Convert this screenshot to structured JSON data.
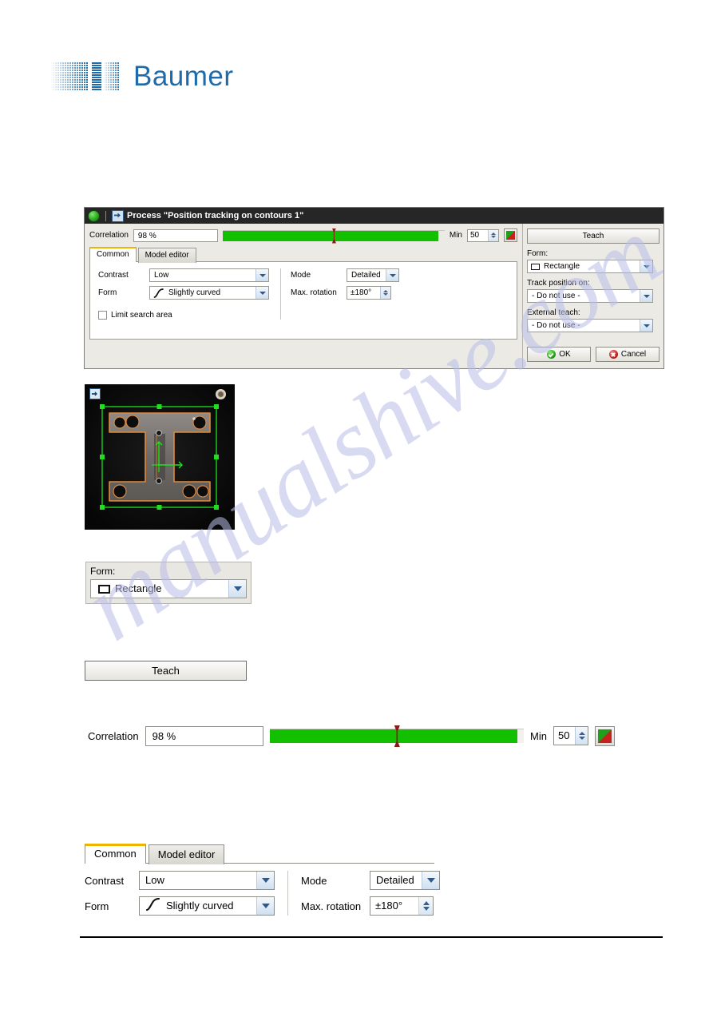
{
  "brand": {
    "name": "Baumer",
    "logo_color": "#1f6aa8"
  },
  "watermark": {
    "text": "manualshive.com"
  },
  "dialog": {
    "titlebar": {
      "title": "Process \"Position tracking on contours 1\"",
      "status_icon": "green-status-circle-icon",
      "app_icon": "process-node-icon"
    },
    "correlation": {
      "label": "Correlation",
      "value": "98 %",
      "bar_fill_percent": 100,
      "marker_percent": 50,
      "min_label": "Min",
      "min_value": "50",
      "fill_color": "#12c000",
      "marker_color": "#8a1b16",
      "flag_button_icon": "green-red-diagonal-flag-icon"
    },
    "tabs": [
      {
        "label": "Common",
        "active": true
      },
      {
        "label": "Model editor",
        "active": false
      }
    ],
    "common_tab": {
      "contrast_label": "Contrast",
      "contrast_value": "Low",
      "form_label": "Form",
      "form_value": "Slightly curved",
      "form_icon": "curve-icon",
      "mode_label": "Mode",
      "mode_value": "Detailed",
      "max_rotation_label": "Max. rotation",
      "max_rotation_value": "±180°",
      "limit_search_area_label": "Limit search area",
      "limit_search_area_checked": false
    },
    "right_panel": {
      "teach_label": "Teach",
      "form_label": "Form:",
      "form_value": "Rectangle",
      "form_icon": "rectangle-icon",
      "track_position_label": "Track position on:",
      "track_position_value": "- Do not use -",
      "external_teach_label": "External teach:",
      "external_teach_value": "- Do not use -",
      "ok_label": "OK",
      "cancel_label": "Cancel"
    }
  },
  "preview": {
    "overlay_icon": "process-node-icon",
    "corner_knob_icon": "round-knob-icon",
    "roi_color": "#1ee01e",
    "contour_color": "#e08a3c",
    "background_color": "#090909"
  },
  "form_zoom": {
    "label": "Form:",
    "value": "Rectangle",
    "icon": "rectangle-icon"
  },
  "teach_zoom": {
    "label": "Teach"
  },
  "correlation_zoom": {
    "label": "Correlation",
    "value": "98 %",
    "bar_fill_percent": 100,
    "marker_percent": 50,
    "min_label": "Min",
    "min_value": "50",
    "flag_button_icon": "green-red-diagonal-flag-icon"
  },
  "tabs_zoom": {
    "tabs": [
      {
        "label": "Common",
        "active": true
      },
      {
        "label": "Model editor",
        "active": false
      }
    ],
    "contrast_label": "Contrast",
    "contrast_value": "Low",
    "form_label": "Form",
    "form_value": "Slightly curved",
    "form_icon": "curve-icon",
    "mode_label": "Mode",
    "mode_value": "Detailed",
    "max_rotation_label": "Max. rotation",
    "max_rotation_value": "±180°"
  }
}
